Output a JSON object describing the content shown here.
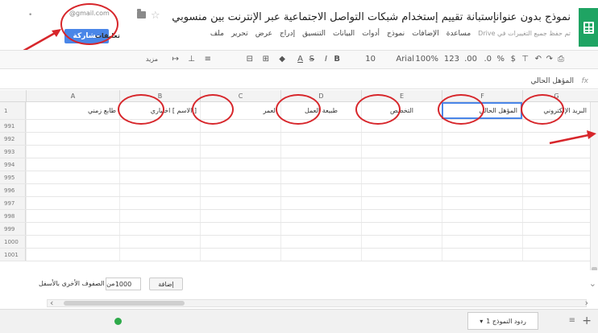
{
  "window": {
    "title": "نموذج بدون عنوانإستبانة تقييم إستخدام شبكات التواصل الاجتماعية عبر الإنترنت بين منسوبي الكلية (أعضاء هيئة تدريس ، وم...",
    "account_email": "@gmail.com",
    "share_label": "مشاركة",
    "share_text": "تعليقات",
    "dots": "•"
  },
  "menu": {
    "items": [
      "ملف",
      "تحرير",
      "عرض",
      "إدراج",
      "التنسيق",
      "البيانات",
      "أدوات",
      "نموذج",
      "الإضافات",
      "مساعدة"
    ],
    "last_edit": "تم حفظ جميع التغييرات في Drive"
  },
  "toolbar": {
    "print": "⎙",
    "undo": "↶",
    "redo": "↷",
    "paint": "⊤",
    "currency": "$",
    "percent": "%",
    "dec_dec": ".0",
    "dec_inc": ".00",
    "format_num": "123",
    "zoom": "100%",
    "font": "Arial",
    "font_size": "10",
    "bold": "B",
    "italic": "I",
    "strike": "S",
    "text_color": "A",
    "fill": "◆",
    "borders": "⊞",
    "merge": "⊟",
    "align": "≡",
    "valign": "⊥",
    "wrap": "↦",
    "more": "مزيد"
  },
  "formula_bar": {
    "fx": "fx",
    "content": "المؤهل الحالي"
  },
  "grid": {
    "col_letters": [
      "G",
      "F",
      "E",
      "D",
      "C",
      "B",
      "A"
    ],
    "header_row_num": "1",
    "headers": [
      "البريد الإلكتروني",
      "المؤهل الحالي",
      "التخصص",
      "طبيعة العمل",
      "العمر",
      "[ الاسم ] اختياري",
      "طابع زمني"
    ],
    "row_numbers": [
      "991",
      "992",
      "993",
      "994",
      "995",
      "996",
      "997",
      "998",
      "999",
      "1000",
      "1001"
    ]
  },
  "add_rows": {
    "button": "إضافة",
    "count": "1000",
    "suffix_text": "من الصفوف الأخرى بالأسفل"
  },
  "sheet_tabs": {
    "active": "ردود النموذج 1",
    "add": "+",
    "list": "≡"
  },
  "colors": {
    "accent": "#4a86e8",
    "sheets_green": "#1fa463",
    "annotation_red": "#d7262b"
  }
}
